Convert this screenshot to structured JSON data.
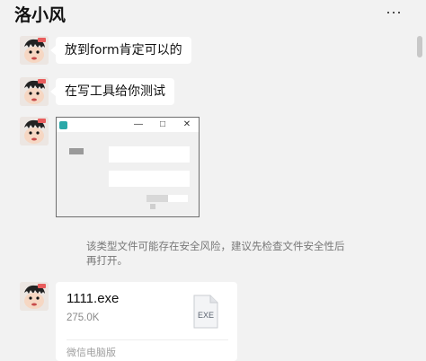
{
  "chat": {
    "contact_name": "洛小风"
  },
  "messages": [
    {
      "text": "放到form肯定可以的"
    },
    {
      "text": "在写工具给你测试"
    }
  ],
  "screenshot_window": {
    "controls": [
      "—",
      "□",
      "✕"
    ]
  },
  "security_notice": "该类型文件可能存在安全风险，建议先检查文件安全性后再打开。",
  "file": {
    "name": "1111.exe",
    "size": "275.0K",
    "ext_label": "EXE",
    "source": "微信电脑版"
  },
  "icons": {
    "more": "more-dots-icon",
    "file": "exe-file-icon",
    "avatar": "cartoon-avatar"
  },
  "colors": {
    "background": "#f2f2f2",
    "bubble": "#ffffff",
    "muted_text": "#777777"
  }
}
